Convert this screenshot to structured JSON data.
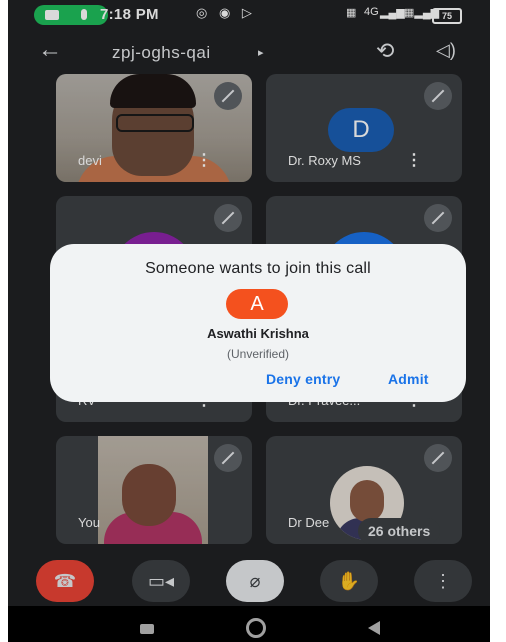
{
  "status_bar": {
    "time": "7:18 PM",
    "icons": "◎ ◉ ▷",
    "signal_1": "4G",
    "battery": "75"
  },
  "top_bar": {
    "meeting_code": "zpj-oghs-qai",
    "caret": "▸"
  },
  "tiles": [
    {
      "name": "devi"
    },
    {
      "name": "Dr. Roxy MS",
      "initial": "D",
      "color": "#1a5fb4"
    },
    {
      "name": "RV"
    },
    {
      "name": "Dr. Pravee..."
    },
    {
      "name": "You"
    },
    {
      "name": "Dr Dee",
      "others_label": "26 others"
    }
  ],
  "dialog": {
    "title": "Someone wants to join this call",
    "avatar_initial": "A",
    "avatar_color": "#f4511e",
    "name": "Aswathi Krishna",
    "subtitle": "(Unverified)",
    "deny_label": "Deny entry",
    "admit_label": "Admit"
  },
  "controls": {
    "end_call": "end-call-icon",
    "camera": "camera-icon",
    "mic": "mic-off-icon",
    "raise_hand": "hand-icon",
    "more": "more-icon"
  },
  "colors": {
    "background": "#202124",
    "tile": "#3c4043",
    "accent": "#1a73e8",
    "end_call": "#ea4335"
  }
}
